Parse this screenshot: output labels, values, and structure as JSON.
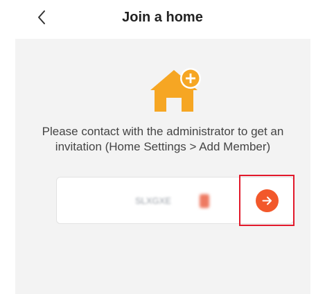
{
  "header": {
    "title": "Join a home",
    "back_icon": "chevron-left-icon"
  },
  "main": {
    "house_icon": "house-add-icon",
    "message_lines": [
      "Please contact with the administrator to get an",
      "invitation (Home Settings > Add Member)"
    ],
    "code_input": {
      "value": "SLXGXE"
    },
    "submit_icon": "arrow-right-icon"
  },
  "colors": {
    "accent": "#f2582b",
    "house": "#f6a623",
    "highlight": "#e2192b",
    "card_background": "#f3f3f3"
  }
}
